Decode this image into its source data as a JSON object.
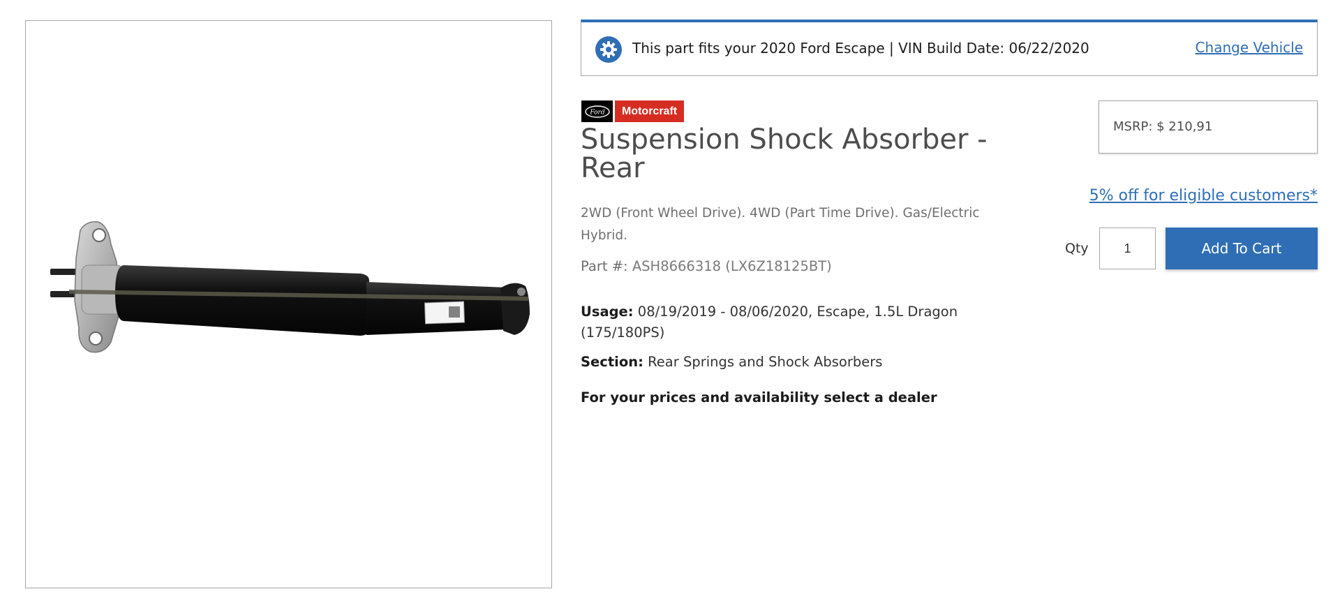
{
  "fitment": {
    "message": "This part fits your 2020 Ford Escape | VIN Build Date: 06/22/2020",
    "change_link": "Change Vehicle"
  },
  "brand": {
    "ford_logo": "Ford",
    "name": "Motorcraft",
    "color": "#d62d22"
  },
  "product": {
    "title": "Suspension Shock Absorber - Rear",
    "description": "2WD (Front Wheel Drive). 4WD (Part Time Drive). Gas/Electric Hybrid.",
    "part_label": "Part #:",
    "part_number": "ASH8666318 (LX6Z18125BT)",
    "usage_label": "Usage:",
    "usage_value": "08/19/2019 - 08/06/2020, Escape, 1.5L Dragon (175/180PS)",
    "section_label": "Section:",
    "section_value": "Rear Springs and Shock Absorbers",
    "dealer_prompt": "For your prices and availability select a dealer"
  },
  "pricing": {
    "msrp_label": "MSRP:",
    "msrp_value": "$ 210,91",
    "discount_link": "5% off for eligible customers*"
  },
  "cart": {
    "qty_label": "Qty",
    "qty_value": "1",
    "add_button": "Add To Cart"
  },
  "colors": {
    "accent": "#2f6eb5",
    "border": "#a6a6a6"
  },
  "icons": {
    "fitment_icon": "gear-check-icon"
  }
}
